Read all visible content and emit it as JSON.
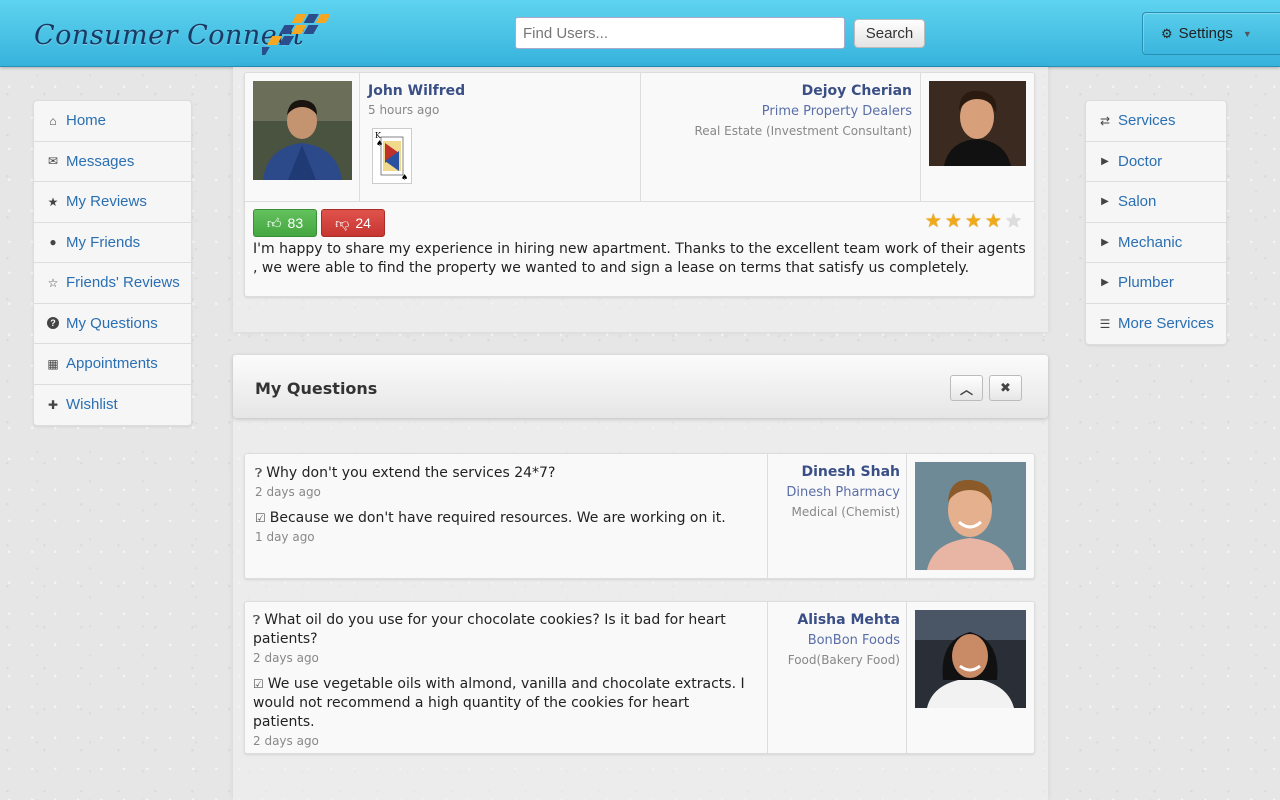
{
  "header": {
    "brand": "Consumer Connect",
    "search_placeholder": "Find Users...",
    "search_button": "Search",
    "settings_label": "Settings",
    "brand_color": "#1a3a66",
    "accent": "#36b3dc"
  },
  "left_nav": [
    {
      "icon": "home-icon",
      "glyph": "⌂",
      "label": "Home"
    },
    {
      "icon": "envelope-icon",
      "glyph": "✉",
      "label": "Messages"
    },
    {
      "icon": "star-icon",
      "glyph": "★",
      "label": "My Reviews"
    },
    {
      "icon": "user-icon",
      "glyph": "●",
      "label": "My Friends"
    },
    {
      "icon": "star-outline-icon",
      "glyph": "☆",
      "label": "Friends' Reviews"
    },
    {
      "icon": "question-icon",
      "glyph": "?",
      "label": "My Questions"
    },
    {
      "icon": "calendar-icon",
      "glyph": "▦",
      "label": "Appointments"
    },
    {
      "icon": "gift-icon",
      "glyph": "✚",
      "label": "Wishlist"
    }
  ],
  "right_nav": [
    {
      "icon": "shuffle-icon",
      "glyph": "⇄",
      "label": "Services"
    },
    {
      "icon": "play-icon",
      "glyph": "▶",
      "label": "Doctor"
    },
    {
      "icon": "play-icon",
      "glyph": "▶",
      "label": "Salon"
    },
    {
      "icon": "play-icon",
      "glyph": "▶",
      "label": "Mechanic"
    },
    {
      "icon": "play-icon",
      "glyph": "▶",
      "label": "Plumber"
    },
    {
      "icon": "list-icon",
      "glyph": "☰",
      "label": "More Services"
    }
  ],
  "review": {
    "reviewer_name": "John Wilfred",
    "time": "5 hours ago",
    "business_owner": "Dejoy Cherian",
    "business_name": "Prime Property Dealers",
    "category": "Real Estate (Investment Consultant)",
    "upvotes": "83",
    "downvotes": "24",
    "rating": 4,
    "rating_max": 5,
    "text": "I'm happy to share my experience in hiring new apartment. Thanks to the excellent team work of their agents , we were able to find the property we wanted to and sign a lease on terms that satisfy us completely."
  },
  "questions_panel": {
    "title": "My Questions",
    "items": [
      {
        "question": "Why don't you extend the services 24*7?",
        "question_time": "2 days ago",
        "answer": "Because we don't have required resources. We are working on it.",
        "answer_time": "1 day ago",
        "owner": "Dinesh Shah",
        "business": "Dinesh Pharmacy",
        "category": "Medical (Chemist)"
      },
      {
        "question": "What oil do you use for your chocolate cookies? Is it bad for heart patients?",
        "question_time": "2 days ago",
        "answer": "We use vegetable oils with almond, vanilla and chocolate extracts. I would not recommend a high quantity of the cookies for heart patients.",
        "answer_time": "2 days ago",
        "owner": "Alisha Mehta",
        "business": "BonBon Foods",
        "category": "Food(Bakery Food)"
      }
    ]
  }
}
